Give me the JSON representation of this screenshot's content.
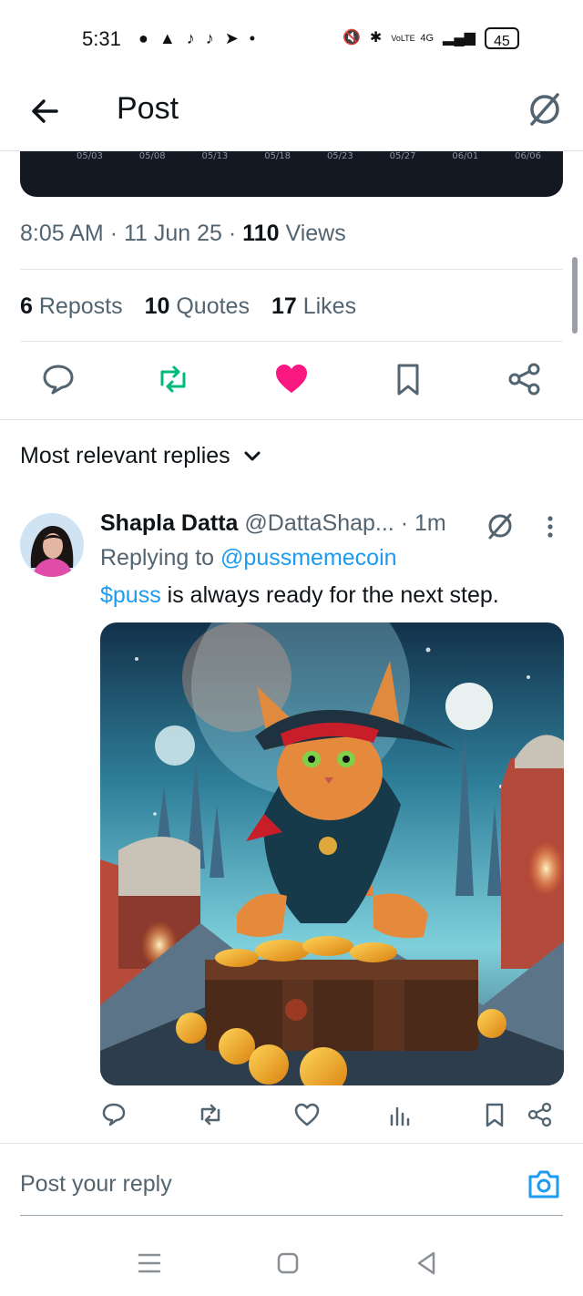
{
  "status_bar": {
    "time": "5:31",
    "left_icons": [
      "message-icon",
      "game-icon",
      "tiktok-icon",
      "tiktok-icon",
      "send-icon",
      "dot-icon"
    ],
    "volte": "VoLTE",
    "network": "4G",
    "battery": "45"
  },
  "header": {
    "title": "Post"
  },
  "chart_ticks": [
    "05/03",
    "05/08",
    "05/13",
    "05/18",
    "05/23",
    "05/27",
    "06/01",
    "06/06"
  ],
  "meta": {
    "time": "8:05 AM",
    "date": "11 Jun 25",
    "views_count": "110",
    "views_label": "Views"
  },
  "stats": {
    "reposts_count": "6",
    "reposts_label": "Reposts",
    "quotes_count": "10",
    "quotes_label": "Quotes",
    "likes_count": "17",
    "likes_label": "Likes"
  },
  "sort": {
    "label": "Most relevant replies"
  },
  "reply": {
    "name": "Shapla Datta",
    "handle": "@DattaShap...",
    "time": "· 1m",
    "replying_prefix": "Replying to",
    "replying_to": "@pussmemecoin",
    "tag": "$puss",
    "text": " is always ready for the next step."
  },
  "composer": {
    "placeholder": "Post your reply"
  },
  "colors": {
    "accent": "#1d9bf0",
    "like": "#f91880",
    "repost": "#00ba7c",
    "text": "#0f1419",
    "muted": "#536471"
  }
}
